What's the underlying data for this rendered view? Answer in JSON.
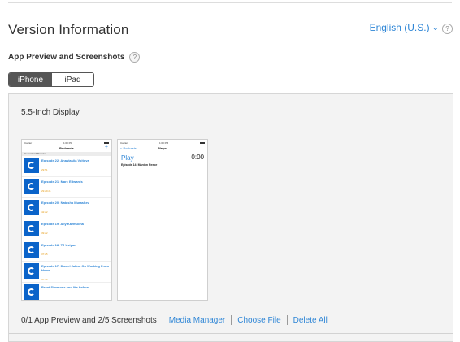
{
  "header": {
    "title": "Version Information",
    "language": "English (U.S.)",
    "help_glyph": "?"
  },
  "section": {
    "title": "App Preview and Screenshots",
    "help_glyph": "?"
  },
  "device_tabs": [
    {
      "label": "iPhone",
      "selected": true
    },
    {
      "label": "iPad",
      "selected": false
    }
  ],
  "panel": {
    "title": "5.5-Inch Display",
    "count_text": "0/1 App Preview and 2/5 Screenshots",
    "actions": [
      "Media Manager",
      "Choose File",
      "Delete All"
    ]
  },
  "screenshot1": {
    "status_left": "Carrier",
    "status_time": "1:00 PM",
    "nav_title": "Podcasts",
    "nav_plus": "+",
    "list_header": "CocoaConf Podcast",
    "episodes": [
      {
        "title": "Episode 22: Anastasiia Voitova",
        "duration": "29:51"
      },
      {
        "title": "Episode 21: Marc Edwards",
        "duration": "29:29:21"
      },
      {
        "title": "Episode 20: Natasha Murashev",
        "duration": "42:22"
      },
      {
        "title": "Episode 19: Ally Kazmucha",
        "duration": "39:22"
      },
      {
        "title": "Episode 18: TJ Usiyan",
        "duration": "37:25"
      },
      {
        "title": "Episode 17: Daniel Jalkut On Working From Home",
        "duration": "47:53"
      },
      {
        "title": "Brent Simmons and life before",
        "duration": ""
      }
    ]
  },
  "screenshot2": {
    "status_left": "Carrier",
    "status_time": "1:00 PM",
    "back_label": "< Podcasts",
    "nav_title": "Player",
    "play_label": "Play",
    "time": "0:00",
    "episode": "Episode 14: Manton Reece"
  },
  "colors": {
    "link": "#2f86d6",
    "podcast_art": "#0a63c9",
    "duration": "#e6a020",
    "segment_selected": "#555555"
  },
  "icons": {
    "help": "question-circle-icon",
    "language_chevron": "chevron-down-icon",
    "podcast_art": "cocoaconf-logo-icon"
  }
}
